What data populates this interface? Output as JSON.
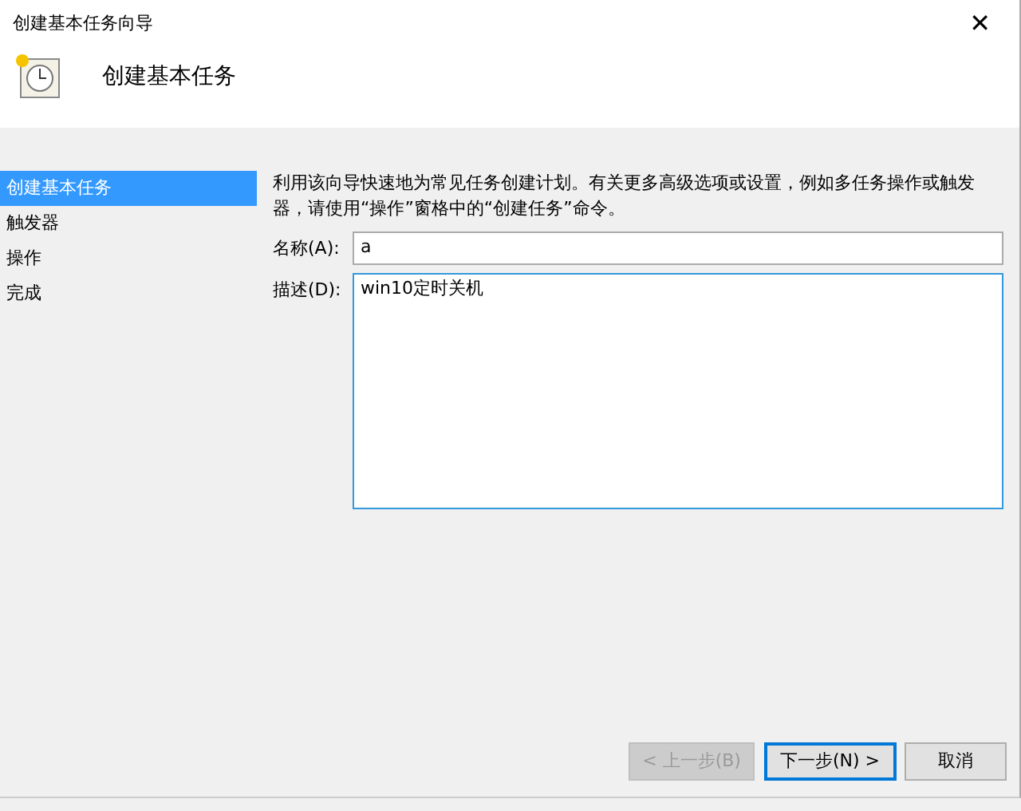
{
  "window": {
    "title": "创建基本任务向导",
    "close": "✕"
  },
  "header": {
    "title": "创建基本任务"
  },
  "sidebar": {
    "items": [
      {
        "label": "创建基本任务",
        "selected": true
      },
      {
        "label": "触发器",
        "selected": false
      },
      {
        "label": "操作",
        "selected": false
      },
      {
        "label": "完成",
        "selected": false
      }
    ]
  },
  "description": "利用该向导快速地为常见任务创建计划。有关更多高级选项或设置，例如多任务操作或触发器，请使用“操作”窗格中的“创建任务”命令。",
  "fields": [
    {
      "kind": "input",
      "label": "名称(A):",
      "value": "a"
    },
    {
      "kind": "textarea",
      "label": "描述(D):",
      "value": "win10定时关机"
    }
  ],
  "buttons": [
    {
      "label": "< 上一步(B)",
      "disabled": true,
      "default": false
    },
    {
      "label": "下一步(N) >",
      "disabled": false,
      "default": true
    },
    {
      "label": "取消",
      "disabled": false,
      "default": false
    }
  ]
}
